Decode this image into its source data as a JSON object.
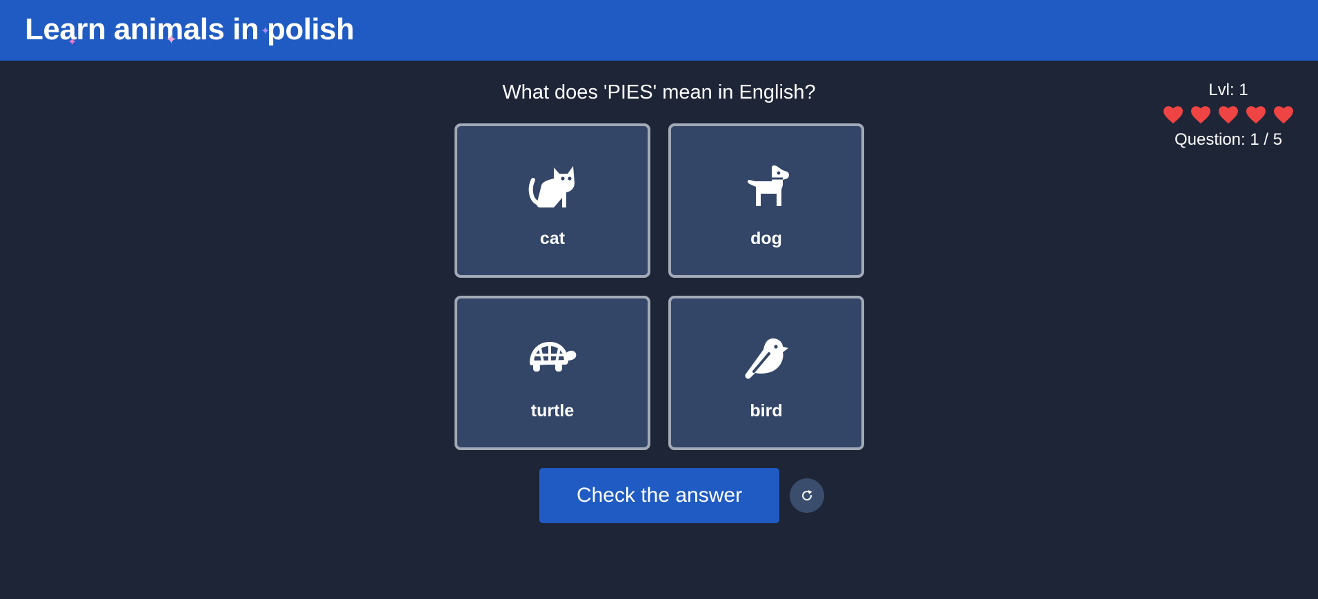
{
  "app": {
    "title": "Learn animals in polish",
    "brand_color": "#1f5bc2",
    "background_color": "#1e2536"
  },
  "quiz": {
    "question": "What does 'PIES' mean in English?",
    "options": [
      {
        "label": "cat",
        "icon": "cat-icon"
      },
      {
        "label": "dog",
        "icon": "dog-icon"
      },
      {
        "label": "turtle",
        "icon": "turtle-icon"
      },
      {
        "label": "bird",
        "icon": "bird-icon"
      }
    ],
    "check_label": "Check the answer",
    "reset_icon": "refresh-icon"
  },
  "stats": {
    "level": "Lvl: 1",
    "lives": 5,
    "heart_color": "#ef4444",
    "question_counter": "Question: 1 / 5"
  }
}
